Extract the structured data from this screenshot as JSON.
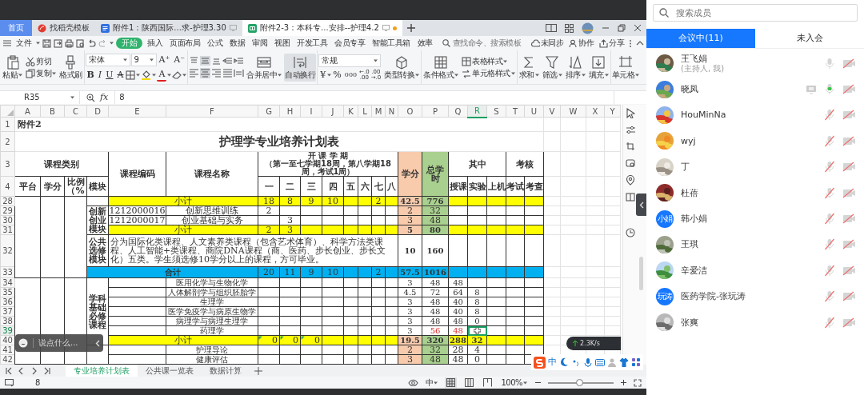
{
  "doc_tabs": [
    {
      "label": "首页",
      "selected": false,
      "kind": "home",
      "modified": false
    },
    {
      "label": "找稻壳模板",
      "selected": false,
      "kind": "docer",
      "modified": false
    },
    {
      "label": "附件1：陕西国际...求-护理3.30",
      "selected": false,
      "kind": "writer",
      "modified": false
    },
    {
      "label": "附件2-3：本科专...安排--护理4.2",
      "selected": true,
      "kind": "sheet",
      "modified": true
    }
  ],
  "menu": {
    "file": "文件",
    "items": [
      {
        "label": "开始",
        "selected": true
      },
      {
        "label": "插入",
        "selected": false
      },
      {
        "label": "页面布局",
        "selected": false
      },
      {
        "label": "公式",
        "selected": false
      },
      {
        "label": "数据",
        "selected": false
      },
      {
        "label": "审阅",
        "selected": false
      },
      {
        "label": "视图",
        "selected": false
      },
      {
        "label": "开发工具",
        "selected": false
      },
      {
        "label": "会员专享",
        "selected": false
      },
      {
        "label": "智能工具箱",
        "selected": false
      },
      {
        "label": "效率",
        "selected": false
      }
    ],
    "search_placeholder": "查找命令、搜索模板",
    "sync": "未同步",
    "collab": "协作",
    "share": "分享"
  },
  "ribbon": {
    "paste": "粘贴",
    "cut": "剪切",
    "copy": "复制",
    "format_painter": "格式刷",
    "font": "宋体",
    "size": "9",
    "font_grow": "A⁺",
    "font_shrink": "A⁻",
    "bold": "B",
    "italic": "I",
    "underline": "U",
    "strike": "A",
    "font_color": "A",
    "vertical_align": [
      {
        "selected": false
      },
      {
        "selected": true
      },
      {
        "selected": false
      }
    ],
    "horizontal_align": [
      {
        "selected": false
      },
      {
        "selected": true
      },
      {
        "selected": false
      },
      {
        "selected": false
      },
      {
        "selected": false
      }
    ],
    "merge": "合并居中",
    "wrap": {
      "label": "自动换行",
      "on": true
    },
    "number_format": "常规",
    "currency": "¥",
    "percent": "%",
    "thousands": "000",
    "inc_decimal": [
      "←.0",
      ".00"
    ],
    "dec_decimal": [
      ".00",
      "→.0"
    ],
    "convert": "类型转换",
    "cond_format": "条件格式",
    "table_style": "表格样式",
    "cell_style": "单元格样式",
    "sum": "求和",
    "filter": "筛选",
    "sort": "排序",
    "fill": "填充",
    "cell": "单元格"
  },
  "formula_bar": {
    "name_box": "R35",
    "fx": "fx",
    "formula": "8"
  },
  "sheet": {
    "columns": [
      {
        "label": "A",
        "selected": false
      },
      {
        "label": "B",
        "selected": false
      },
      {
        "label": "C",
        "selected": false
      },
      {
        "label": "D",
        "selected": false
      },
      {
        "label": "E",
        "selected": false
      },
      {
        "label": "F",
        "selected": false
      },
      {
        "label": "G",
        "selected": false
      },
      {
        "label": "H",
        "selected": false
      },
      {
        "label": "I",
        "selected": false
      },
      {
        "label": "J",
        "selected": false
      },
      {
        "label": "K",
        "selected": false
      },
      {
        "label": "L",
        "selected": false
      },
      {
        "label": "M",
        "selected": false
      },
      {
        "label": "N",
        "selected": false
      },
      {
        "label": "O",
        "selected": false
      },
      {
        "label": "P",
        "selected": false
      },
      {
        "label": "Q",
        "selected": false
      },
      {
        "label": "R",
        "selected": true
      },
      {
        "label": "S",
        "selected": false
      },
      {
        "label": "T",
        "selected": false
      },
      {
        "label": "U",
        "selected": false
      },
      {
        "label": "V",
        "selected": false
      },
      {
        "label": "W",
        "selected": false
      },
      {
        "label": "X",
        "selected": false
      },
      {
        "label": "Y",
        "selected": false
      }
    ],
    "rows": [
      {
        "number": "1",
        "selected": false,
        "cells": {
          "A": {
            "text": "附件2",
            "kind": "note"
          }
        }
      },
      {
        "number": "2",
        "selected": false,
        "cells": {
          "A": {
            "text": "护理学专业培养计划表",
            "kind": "title"
          }
        }
      },
      {
        "number": "3",
        "selected": false,
        "cells": {
          "A": {
            "text": "课程类别",
            "kind": "heading"
          },
          "E": {
            "text": "课程编码",
            "kind": "heading"
          },
          "F": {
            "text": "课程名称",
            "kind": "heading"
          },
          "G": {
            "text": "开 课 学 期",
            "note": "（第一至七学期18周，第八学期18周，考试1周）",
            "kind": "heading"
          },
          "O": {
            "text": "学分",
            "kind": "heading",
            "color": "#f8cbad"
          },
          "P": {
            "text": "总学时",
            "kind": "heading",
            "color": "#a9d08e"
          },
          "Q": {
            "text": "其中",
            "kind": "heading"
          },
          "T": {
            "text": "考核",
            "kind": "heading"
          }
        }
      },
      {
        "number": "4",
        "selected": false,
        "cells": {
          "A": {
            "text": "平台",
            "kind": "heading"
          },
          "B": {
            "text": "学分",
            "kind": "heading"
          },
          "C": {
            "text": "比例（%",
            "kind": "heading"
          },
          "D": {
            "text": "模块",
            "kind": "heading"
          },
          "G": {
            "text": "一",
            "kind": "heading"
          },
          "H": {
            "text": "二",
            "kind": "heading"
          },
          "I": {
            "text": "三",
            "kind": "heading"
          },
          "J": {
            "text": "四",
            "kind": "heading"
          },
          "K": {
            "text": "五",
            "kind": "heading"
          },
          "L": {
            "text": "六",
            "kind": "heading"
          },
          "M": {
            "text": "七",
            "kind": "heading"
          },
          "N": {
            "text": "八",
            "kind": "heading"
          },
          "Q": {
            "text": "授课",
            "kind": "heading"
          },
          "R": {
            "text": "实验",
            "kind": "heading"
          },
          "S": {
            "text": "上机",
            "kind": "heading"
          },
          "T": {
            "text": "考试",
            "kind": "heading"
          },
          "U": {
            "text": "考查",
            "kind": "heading"
          }
        }
      },
      {
        "number": "28",
        "selected": false,
        "cells": {
          "E": {
            "text": "小计",
            "color": "#ffff00"
          },
          "G": {
            "text": "18",
            "color": "#ffff00"
          },
          "H": {
            "text": "8",
            "color": "#ffff00"
          },
          "I": {
            "text": "9",
            "color": "#ffff00"
          },
          "J": {
            "text": "10",
            "color": "#ffff00"
          },
          "K": {
            "color": "#ffff00"
          },
          "L": {
            "color": "#ffff00"
          },
          "M": {
            "text": "2",
            "color": "#ffff00"
          },
          "N": {
            "color": "#ffff00"
          },
          "O": {
            "text": "42.5",
            "kind": "bold",
            "color": "#f8cbad"
          },
          "P": {
            "text": "776",
            "kind": "bold",
            "color": "#a9d08e"
          },
          "Q": {
            "color": "#ffff00"
          },
          "R": {
            "color": "#ffff00"
          },
          "S": {
            "color": "#ffff00"
          },
          "T": {
            "color": "#ffff00"
          },
          "U": {
            "color": "#ffff00"
          }
        }
      },
      {
        "number": "29",
        "selected": false,
        "cells": {
          "D": {
            "text": "创新创业模块",
            "kind": "heading"
          },
          "E": {
            "text": "1212000016"
          },
          "F": {
            "text": "创新思维训练"
          },
          "G": {
            "text": "2"
          },
          "O": {
            "text": "2",
            "color": "#f8cbad"
          },
          "P": {
            "text": "32",
            "color": "#a9d08e"
          }
        }
      },
      {
        "number": "30",
        "selected": false,
        "cells": {
          "E": {
            "text": "1212000017"
          },
          "F": {
            "text": "创业基础与实务"
          },
          "H": {
            "text": "3"
          },
          "O": {
            "text": "3",
            "color": "#f8cbad"
          },
          "P": {
            "text": "48",
            "color": "#a9d08e"
          }
        }
      },
      {
        "number": "31",
        "selected": false,
        "cells": {
          "E": {
            "text": "小计",
            "color": "#ffff00"
          },
          "G": {
            "text": "2",
            "color": "#ffff00"
          },
          "H": {
            "text": "3",
            "color": "#ffff00"
          },
          "I": {
            "color": "#ffff00"
          },
          "J": {
            "color": "#ffff00"
          },
          "K": {
            "color": "#ffff00"
          },
          "L": {
            "color": "#ffff00"
          },
          "M": {
            "color": "#ffff00"
          },
          "N": {
            "color": "#ffff00"
          },
          "O": {
            "text": "5",
            "kind": "bold",
            "color": "#f8cbad"
          },
          "P": {
            "text": "80",
            "kind": "bold",
            "color": "#a9d08e"
          },
          "Q": {
            "color": "#ffff00"
          },
          "R": {
            "color": "#ffff00"
          },
          "S": {
            "color": "#ffff00"
          },
          "T": {
            "color": "#ffff00"
          },
          "U": {
            "color": "#ffff00"
          }
        }
      },
      {
        "number": "32",
        "selected": false,
        "cells": {
          "D": {
            "text": "公共选修模块",
            "kind": "heading"
          },
          "E": {
            "text": "分为国际化类课程、人文素养类课程（包含艺术体育）、科学方法类课程、人工智能+类课程、商院DNA课程（商、医药、步长创业、步长文化）五类。学生须选修10学分以上的课程，方可毕业。",
            "kind": "left"
          },
          "O": {
            "text": "10",
            "kind": "bold"
          },
          "P": {
            "text": "160",
            "kind": "bold"
          }
        }
      },
      {
        "number": "33",
        "selected": false,
        "cells": {
          "D": {
            "text": "合计",
            "kind": "bold",
            "color": "#00b0f0"
          },
          "G": {
            "text": "20",
            "color": "#00b0f0"
          },
          "H": {
            "text": "11",
            "color": "#00b0f0"
          },
          "I": {
            "text": "9",
            "color": "#00b0f0"
          },
          "J": {
            "text": "10",
            "color": "#00b0f0"
          },
          "K": {
            "color": "#00b0f0"
          },
          "L": {
            "color": "#00b0f0"
          },
          "M": {
            "text": "2",
            "color": "#00b0f0"
          },
          "N": {
            "color": "#00b0f0"
          },
          "O": {
            "text": "57.5",
            "kind": "bold",
            "color": "#00b0f0"
          },
          "P": {
            "text": "1016",
            "kind": "bold",
            "color": "#00b0f0"
          },
          "Q": {
            "color": "#00b0f0"
          },
          "R": {
            "color": "#00b0f0"
          },
          "S": {
            "color": "#00b0f0"
          },
          "T": {
            "color": "#00b0f0"
          },
          "U": {
            "color": "#00b0f0"
          }
        }
      },
      {
        "number": "34",
        "selected": false,
        "cells": {
          "D": {
            "text": "学科基础必修课程",
            "kind": "heading"
          },
          "F": {
            "text": "医用化学与生物化学",
            "kind": "small"
          },
          "O": {
            "text": "3",
            "kind": "small"
          },
          "P": {
            "text": "48",
            "kind": "small"
          },
          "Q": {
            "text": "48",
            "kind": "small"
          }
        }
      },
      {
        "number": "35",
        "selected": false,
        "cells": {
          "F": {
            "text": "人体解剖学与组织胚胎学",
            "kind": "small"
          },
          "O": {
            "text": "4.5",
            "kind": "small"
          },
          "P": {
            "text": "72",
            "kind": "small"
          },
          "Q": {
            "text": "64",
            "kind": "small"
          },
          "R": {
            "text": "8",
            "kind": "small"
          }
        }
      },
      {
        "number": "36",
        "selected": false,
        "cells": {
          "F": {
            "text": "生理学",
            "kind": "small"
          },
          "O": {
            "text": "3",
            "kind": "small"
          },
          "P": {
            "text": "48",
            "kind": "small"
          },
          "Q": {
            "text": "40",
            "kind": "small"
          },
          "R": {
            "text": "8",
            "kind": "small"
          }
        }
      },
      {
        "number": "37",
        "selected": false,
        "cells": {
          "F": {
            "text": "医学免疫学与病原生物学",
            "kind": "small"
          },
          "O": {
            "text": "3",
            "kind": "small"
          },
          "P": {
            "text": "48",
            "kind": "small"
          },
          "Q": {
            "text": "40",
            "kind": "small"
          },
          "R": {
            "text": "8",
            "kind": "small"
          }
        }
      },
      {
        "number": "38",
        "selected": false,
        "cells": {
          "F": {
            "text": "病理学与病理生理学",
            "kind": "small"
          },
          "O": {
            "text": "3",
            "kind": "small"
          },
          "P": {
            "text": "48",
            "kind": "small"
          },
          "Q": {
            "text": "48",
            "kind": "small"
          },
          "R": {
            "text": "0",
            "kind": "small"
          }
        }
      },
      {
        "number": "39",
        "selected": true,
        "cells": {
          "F": {
            "text": "药理学",
            "kind": "small"
          },
          "O": {
            "text": "3",
            "kind": "small"
          },
          "P": {
            "text": "56",
            "kind": "red"
          },
          "Q": {
            "text": "48",
            "kind": "red"
          }
        }
      },
      {
        "number": "40",
        "selected": false,
        "cells": {
          "E": {
            "text": "小计",
            "color": "#ffff00"
          },
          "G": {
            "text": "0",
            "kind": "flag",
            "color": "#ffff00"
          },
          "H": {
            "text": "0",
            "kind": "flag",
            "color": "#ffff00"
          },
          "I": {
            "text": "0",
            "kind": "flag",
            "color": "#ffff00"
          },
          "J": {
            "color": "#ffff00"
          },
          "K": {
            "color": "#ffff00"
          },
          "L": {
            "color": "#ffff00"
          },
          "M": {
            "color": "#ffff00"
          },
          "N": {
            "color": "#ffff00"
          },
          "O": {
            "text": "19.5",
            "kind": "bold",
            "color": "#f8cbad"
          },
          "P": {
            "text": "320",
            "kind": "bold",
            "color": "#a9d08e"
          },
          "Q": {
            "text": "288",
            "kind": "bold",
            "color": "#ffff00"
          },
          "R": {
            "text": "32",
            "kind": "bold",
            "color": "#ffff00"
          },
          "S": {
            "color": "#ffff00"
          },
          "T": {
            "color": "#ffff00"
          },
          "U": {
            "color": "#ffff00"
          }
        }
      },
      {
        "number": "41",
        "selected": false,
        "cells": {
          "F": {
            "text": "护理导论",
            "kind": "small"
          },
          "O": {
            "text": "2",
            "color": "#f8cbad"
          },
          "P": {
            "text": "32",
            "color": "#a9d08e"
          },
          "Q": {
            "text": "28"
          },
          "R": {
            "text": "4"
          }
        }
      },
      {
        "number": "42",
        "selected": false,
        "cells": {
          "F": {
            "text": "健康评估",
            "kind": "small"
          },
          "O": {
            "text": "3",
            "color": "#f8cbad"
          },
          "P": {
            "text": "48",
            "color": "#a9d08e"
          },
          "Q": {
            "text": "48"
          },
          "R": {
            "text": "0"
          }
        }
      }
    ]
  },
  "sheet_tabs": [
    {
      "label": "专业培养计划表",
      "selected": true
    },
    {
      "label": "公共课一览表",
      "selected": false
    },
    {
      "label": "数据计算",
      "selected": false
    }
  ],
  "chat": {
    "placeholder": "说点什么..."
  },
  "speed": "2.3K/s",
  "ime": {
    "mode": "中"
  },
  "status_bar": {
    "value": "8",
    "input_mode": "中",
    "views": [
      {
        "selected": true
      },
      {
        "selected": false
      },
      {
        "selected": false
      }
    ],
    "zoom": "100%",
    "zoom_slider": {
      "level": 0.48
    }
  },
  "members_panel": {
    "search_placeholder": "搜索成员",
    "tabs": [
      {
        "label": "会议中(11)",
        "selected": true
      },
      {
        "label": "未入会",
        "selected": false
      }
    ],
    "members": [
      {
        "name": "王飞娟",
        "subtitle": "(主持人, 我)",
        "muted": false,
        "speaking": false,
        "sharing": false,
        "camera_on": false
      },
      {
        "name": "晓凤",
        "muted": false,
        "speaking": true,
        "sharing": true,
        "camera_on": false
      },
      {
        "name": "HouMinNa",
        "muted": true,
        "speaking": false,
        "sharing": false,
        "camera_on": false
      },
      {
        "name": "wyj",
        "muted": true,
        "speaking": false,
        "sharing": false,
        "camera_on": false
      },
      {
        "name": "丁",
        "muted": true,
        "speaking": false,
        "sharing": false,
        "camera_on": false
      },
      {
        "name": "杜蓓",
        "muted": true,
        "speaking": false,
        "sharing": false,
        "camera_on": false
      },
      {
        "name": "韩小娟",
        "avatar": {
          "kind": "text",
          "text": "小娟"
        },
        "muted": true,
        "speaking": false,
        "sharing": false,
        "camera_on": false
      },
      {
        "name": "王琪",
        "muted": true,
        "speaking": false,
        "sharing": false,
        "camera_on": false
      },
      {
        "name": "辛爱洁",
        "muted": true,
        "speaking": false,
        "sharing": false,
        "camera_on": false
      },
      {
        "name": "医药学院-张玩涛",
        "avatar": {
          "kind": "text",
          "text": "玩涛"
        },
        "muted": true,
        "speaking": false,
        "sharing": false,
        "camera_on": false
      },
      {
        "name": "张爽",
        "muted": true,
        "speaking": false,
        "sharing": false,
        "camera_on": false
      }
    ]
  }
}
